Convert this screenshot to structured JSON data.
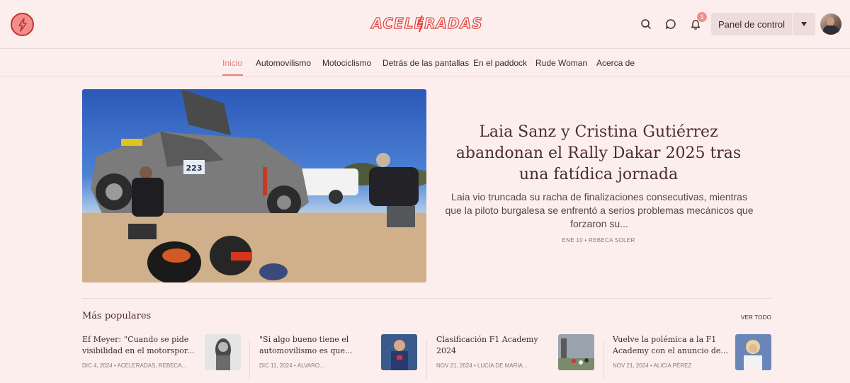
{
  "header": {
    "logo_text": "ACELERADAS",
    "panel_label": "Panel de control",
    "notification_count": "1",
    "icons": [
      "bolt-icon",
      "search-icon",
      "chat-icon",
      "bell-icon",
      "caret-down-icon"
    ]
  },
  "nav": {
    "items": [
      "Inicio",
      "Automovilismo",
      "Motociclismo",
      "Detrás de las pantallas",
      "En el paddock",
      "Rude Woman",
      "Acerca de"
    ],
    "active": "Inicio"
  },
  "hero": {
    "title": "Laia Sanz y Cristina Gutiérrez abandonan el Rally Dakar 2025 tras una fatídica jornada",
    "excerpt": "Laia vio truncada su racha de finalizaciones consecutivas, mientras que la piloto burgalesa se enfrentó a serios problemas mecánicos que forzaron su...",
    "meta": "ENE 10 • REBECA SOLER",
    "car_number": "223"
  },
  "popular": {
    "title": "Más populares",
    "see_all": "VER TODO",
    "cards": [
      {
        "title": "Ef Meyer: “Cuando se pide visibilidad en el motorspor...",
        "meta": "DIC 4, 2024 • ACELERADAS, REBECA..."
      },
      {
        "title": "\"Si algo bueno tiene el automovilismo es que...",
        "meta": "DIC 11, 2024 • ÁLVARO..."
      },
      {
        "title": "Clasificación F1 Academy 2024",
        "meta": "NOV 21, 2024 • LUCÍA DE MARÍA..."
      },
      {
        "title": "Vuelve la polémica a la F1 Academy con el anuncio de...",
        "meta": "NOV 21, 2024 • ALICIA PÉREZ"
      }
    ]
  },
  "colors": {
    "background": "#fdeeee",
    "accent": "#e0807e",
    "brand_red": "#c9302c",
    "title_text": "#4b2d2d"
  }
}
